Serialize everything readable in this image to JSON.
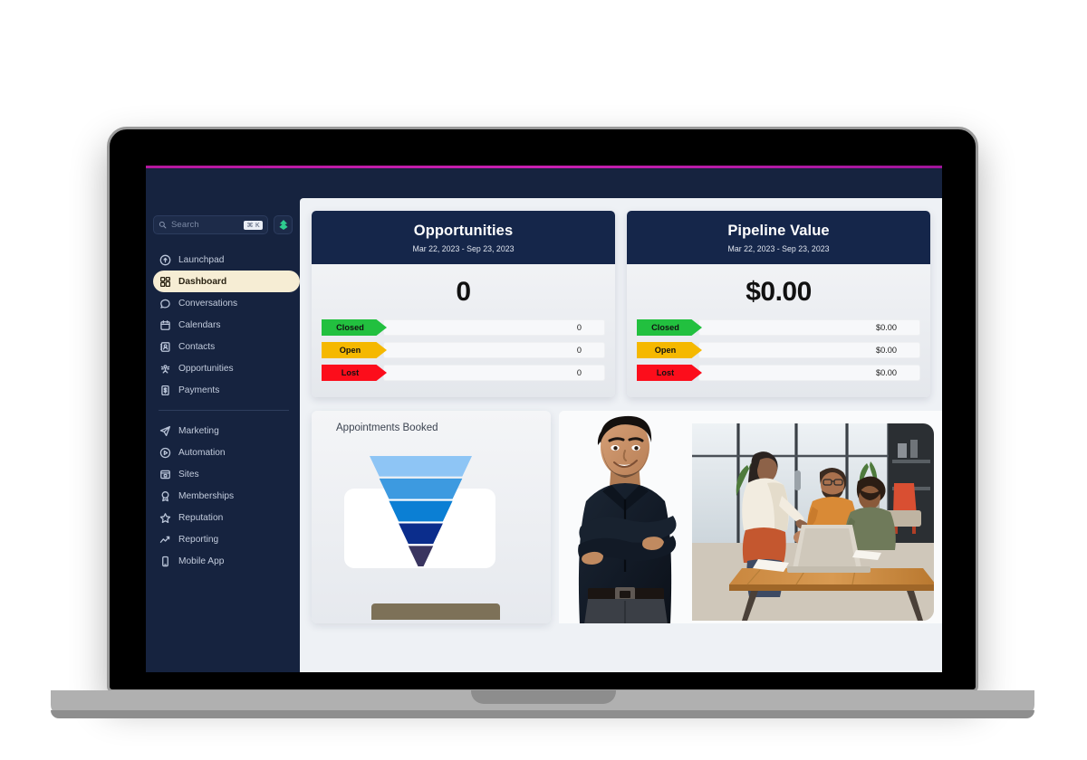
{
  "theme": {
    "sidebar_bg": "#16233f",
    "content_bg": "#eef1f5",
    "card_header_bg": "#15264a",
    "accent_line": "#b5179e",
    "active_nav_bg": "#f6edd4",
    "closed_color": "#22c03f",
    "open_color": "#f5b800",
    "lost_color": "#fc0d1b"
  },
  "sidebar": {
    "search": {
      "placeholder": "Search",
      "shortcut": "⌘ K",
      "icon": "search-icon"
    },
    "quick_action": {
      "icon": "bolt-icon",
      "color": "#2ecc8f"
    },
    "items_top": [
      {
        "label": "Launchpad",
        "icon": "launchpad-icon",
        "active": false
      },
      {
        "label": "Dashboard",
        "icon": "dashboard-grid-icon",
        "active": true
      },
      {
        "label": "Conversations",
        "icon": "chat-bubble-icon",
        "active": false
      },
      {
        "label": "Calendars",
        "icon": "calendar-icon",
        "active": false
      },
      {
        "label": "Contacts",
        "icon": "contacts-book-icon",
        "active": false
      },
      {
        "label": "Opportunities",
        "icon": "opportunities-icon",
        "active": false
      },
      {
        "label": "Payments",
        "icon": "payments-icon",
        "active": false
      }
    ],
    "items_bottom": [
      {
        "label": "Marketing",
        "icon": "paper-plane-icon",
        "active": false
      },
      {
        "label": "Automation",
        "icon": "play-circle-icon",
        "active": false
      },
      {
        "label": "Sites",
        "icon": "browser-window-icon",
        "active": false
      },
      {
        "label": "Memberships",
        "icon": "award-badge-icon",
        "active": false
      },
      {
        "label": "Reputation",
        "icon": "star-icon",
        "active": false
      },
      {
        "label": "Reporting",
        "icon": "trend-up-icon",
        "active": false
      },
      {
        "label": "Mobile App",
        "icon": "mobile-phone-icon",
        "active": false
      }
    ]
  },
  "kpi_cards": [
    {
      "title": "Opportunities",
      "date_range": "Mar 22, 2023 - Sep 23, 2023",
      "total": "0",
      "rows": [
        {
          "label": "Closed",
          "value": "0",
          "color": "#22c03f"
        },
        {
          "label": "Open",
          "value": "0",
          "color": "#f5b800"
        },
        {
          "label": "Lost",
          "value": "0",
          "color": "#fc0d1b"
        }
      ]
    },
    {
      "title": "Pipeline Value",
      "date_range": "Mar 22, 2023 - Sep 23, 2023",
      "total": "$0.00",
      "rows": [
        {
          "label": "Closed",
          "value": "$0.00",
          "color": "#22c03f"
        },
        {
          "label": "Open",
          "value": "$0.00",
          "color": "#f5b800"
        },
        {
          "label": "Lost",
          "value": "$0.00",
          "color": "#fc0d1b"
        }
      ]
    }
  ],
  "funnel_widget": {
    "title": "Appointments Booked",
    "segments": [
      {
        "color": "#8ec5f5"
      },
      {
        "color": "#3d9ae0"
      },
      {
        "color": "#0b7fd4"
      },
      {
        "color": "#0b2d8c"
      },
      {
        "color": "#3a3560"
      }
    ]
  },
  "media": {
    "person_alt": "smiling-man-crossed-arms",
    "office_alt": "office-team-meeting-handshake"
  }
}
